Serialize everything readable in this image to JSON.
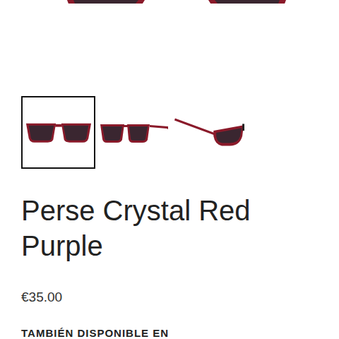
{
  "gallery": {
    "thumbnails": [
      {
        "kind": "front",
        "selected": true
      },
      {
        "kind": "angled",
        "selected": false
      },
      {
        "kind": "side",
        "selected": false
      }
    ]
  },
  "product": {
    "title": "Perse Crystal Red Purple",
    "price": "€35.00"
  },
  "also_available": {
    "heading": "TAMBIÉN DISPONIBLE EN"
  }
}
